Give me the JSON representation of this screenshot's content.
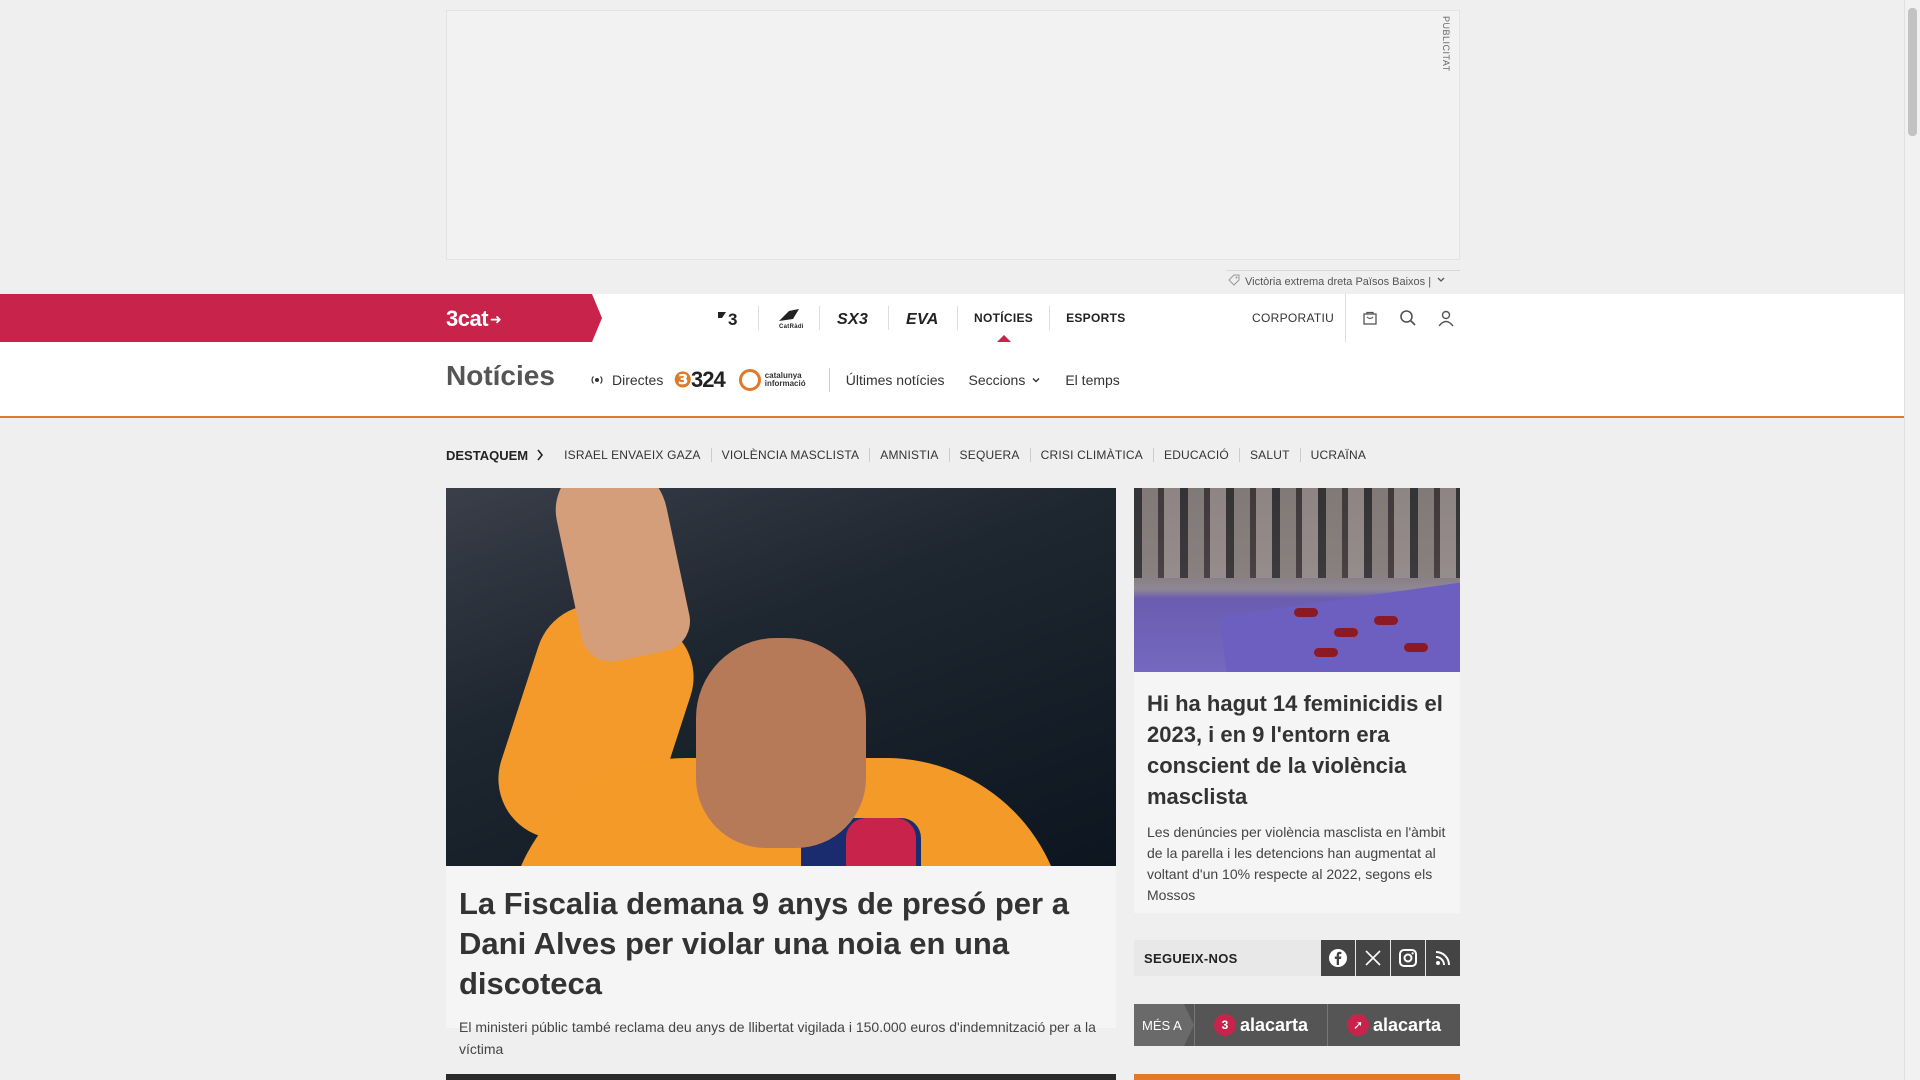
{
  "ad": {
    "label": "PUBLICITAT"
  },
  "ticker": {
    "text": "Victòria extrema dreta Països Baixos |"
  },
  "topnav": {
    "brand": "3cat",
    "channels": [
      {
        "name": "3",
        "label": "3"
      },
      {
        "name": "catradio",
        "label": "Cat Ràdio"
      },
      {
        "name": "sx3",
        "label": "SX3"
      },
      {
        "name": "eva",
        "label": "EVA"
      }
    ],
    "noticies": "NOTÍCIES",
    "esports": "ESPORTS",
    "corporatiu": "CORPORATIU"
  },
  "section": {
    "title": "Notícies",
    "directes": "Directes",
    "logo324": "324",
    "logo_ci": "catalunya informació",
    "links": [
      "Últimes notícies",
      "Seccions",
      "El temps"
    ]
  },
  "destaquem": {
    "label": "DESTAQUEM",
    "tags": [
      "ISRAEL ENVAEIX GAZA",
      "VIOLÈNCIA MASCLISTA",
      "AMNISTIA",
      "SEQUERA",
      "CRISI CLIMÀTICA",
      "EDUCACIÓ",
      "SALUT",
      "UCRAÏNA"
    ]
  },
  "main_article": {
    "title": "La Fiscalia demana 9 anys de presó per a Dani Alves per violar una noia en una discoteca",
    "subtitle": "El ministeri públic també reclama deu anys de llibertat vigilada i 150.000 euros d'indemnització per a la víctima"
  },
  "side_article": {
    "title": "Hi ha hagut 14 feminicidis el 2023, i en 9 l'entorn era conscient de la violència masclista",
    "subtitle": "Les denúncies per violència masclista en l'àmbit de la parella i les detencions han augmentat al voltant d'un 10% respecte al 2022, segons els Mossos"
  },
  "follow": {
    "label": "SEGUEIX-NOS",
    "networks": [
      "facebook-icon",
      "x-icon",
      "instagram-icon",
      "rss-icon"
    ]
  },
  "alacarta": {
    "mes": "MÉS A",
    "items": [
      "alacarta",
      "alacarta"
    ]
  },
  "colors": {
    "brand": "#c8244b",
    "accent": "#e07a2a"
  }
}
